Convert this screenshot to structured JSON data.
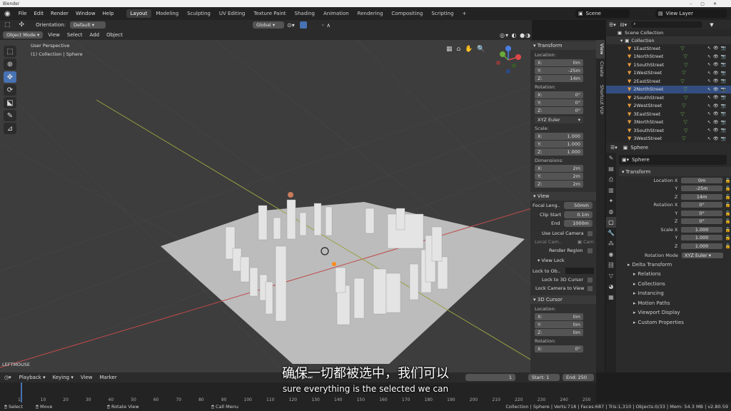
{
  "app": {
    "title": "Blender"
  },
  "menu": [
    "File",
    "Edit",
    "Render",
    "Window",
    "Help"
  ],
  "workspaces": [
    "Layout",
    "Modeling",
    "Sculpting",
    "UV Editing",
    "Texture Paint",
    "Shading",
    "Animation",
    "Rendering",
    "Compositing",
    "Scripting"
  ],
  "active_workspace": "Layout",
  "scene": {
    "name": "Scene",
    "view_layer": "View Layer"
  },
  "header": {
    "orientation_label": "Orientation:",
    "orientation_value": "Default",
    "transform_orientation": "Global"
  },
  "viewport_header": {
    "mode": "Object Mode",
    "menus": [
      "View",
      "Select",
      "Add",
      "Object"
    ]
  },
  "viewport": {
    "perspective": "User Perspective",
    "collection_info": "(1) Collection | Sphere",
    "last_op": "LEFTMOUSE"
  },
  "npanel": {
    "tabs": [
      "View",
      "Create",
      "Shortcut VUr"
    ],
    "transform_title": "Transform",
    "location_label": "Location:",
    "location": [
      {
        "axis": "X:",
        "value": "0m"
      },
      {
        "axis": "Y:",
        "value": "-25m"
      },
      {
        "axis": "Z:",
        "value": "14m"
      }
    ],
    "rotation_label": "Rotation:",
    "rotation": [
      {
        "axis": "X:",
        "value": "0°"
      },
      {
        "axis": "Y:",
        "value": "0°"
      },
      {
        "axis": "Z:",
        "value": "0°"
      }
    ],
    "rotation_mode": "XYZ Euler",
    "scale_label": "Scale:",
    "scale": [
      {
        "axis": "X:",
        "value": "1.000"
      },
      {
        "axis": "Y:",
        "value": "1.000"
      },
      {
        "axis": "Z:",
        "value": "1.000"
      }
    ],
    "dimensions_label": "Dimensions:",
    "dimensions": [
      {
        "axis": "X:",
        "value": "2m"
      },
      {
        "axis": "Y:",
        "value": "2m"
      },
      {
        "axis": "Z:",
        "value": "2m"
      }
    ],
    "view_title": "View",
    "focal_label": "Focal Leng..",
    "focal_value": "50mm",
    "clip_start_label": "Clip Start",
    "clip_start_value": "0.1m",
    "clip_end_label": "End",
    "clip_end_value": "1000m",
    "use_local_camera": "Use Local Camera",
    "local_camera_label": "Local Cam..",
    "local_camera_value": "Cam",
    "render_region": "Render Region",
    "view_lock_title": "View Lock",
    "lock_to_obj": "Lock to Ob..",
    "lock_3d_cursor": "Lock to 3D Cursor",
    "lock_camera": "Lock Camera to View",
    "cursor_title": "3D Cursor",
    "cursor_location_label": "Location:",
    "cursor_location": [
      {
        "axis": "X:",
        "value": "0m"
      },
      {
        "axis": "Y:",
        "value": "0m"
      },
      {
        "axis": "Z:",
        "value": "0m"
      }
    ],
    "cursor_rotation_label": "Rotation:",
    "cursor_rotation_x": {
      "axis": "X:",
      "value": "0°"
    }
  },
  "outliner": {
    "root": "Scene Collection",
    "collection": "Collection",
    "items": [
      "1EastStreet",
      "1NorthStreet",
      "1SouthStreet",
      "1WestStreet",
      "2EastStreet",
      "2NorthStreet",
      "2SouthStreet",
      "2WestStreet",
      "3EastStreet",
      "3NorthStreet",
      "3SouthStreet",
      "3WestStreet"
    ],
    "selected_item": "2NorthStreet"
  },
  "properties": {
    "object_name": "Sphere",
    "object_field": "Sphere",
    "transform_title": "Transform",
    "rows": [
      {
        "label": "Location X",
        "value": "0m"
      },
      {
        "label": "Y",
        "value": "-25m"
      },
      {
        "label": "Z",
        "value": "14m"
      },
      {
        "label": "Rotation X",
        "value": "0°"
      },
      {
        "label": "Y",
        "value": "0°"
      },
      {
        "label": "Z",
        "value": "0°"
      },
      {
        "label": "Scale X",
        "value": "1.000"
      },
      {
        "label": "Y",
        "value": "1.000"
      },
      {
        "label": "Z",
        "value": "1.000"
      }
    ],
    "rotation_mode_label": "Rotation Mode",
    "rotation_mode_value": "XYZ Euler",
    "delta": "Delta Transform",
    "sections": [
      "Relations",
      "Collections",
      "Instancing",
      "Motion Paths",
      "Viewport Display",
      "Custom Properties"
    ]
  },
  "timeline": {
    "menus": [
      "Playback",
      "Keying",
      "View",
      "Marker"
    ],
    "current_frame": "1",
    "start_label": "Start:",
    "start_value": "1",
    "end_label": "End:",
    "end_value": "250",
    "ticks": [
      "1",
      "10",
      "20",
      "30",
      "40",
      "50",
      "60",
      "70",
      "80",
      "90",
      "100",
      "110",
      "120",
      "130",
      "140",
      "150",
      "160",
      "170",
      "180",
      "190",
      "200",
      "210",
      "220",
      "230",
      "240",
      "250"
    ]
  },
  "statusbar": {
    "select": "Select",
    "move": "Move",
    "rotate": "Rotate View",
    "call_menu": "Call Menu",
    "stats": "Collection | Sphere | Verts:718 | Faces:687 | Tris:1,310 | Objects:0/33 | Mem: 54.3 MB | v2.80.59"
  },
  "subtitle": {
    "chinese": "确保一切都被选中，我们可以",
    "english": "sure everything is the selected we can"
  }
}
